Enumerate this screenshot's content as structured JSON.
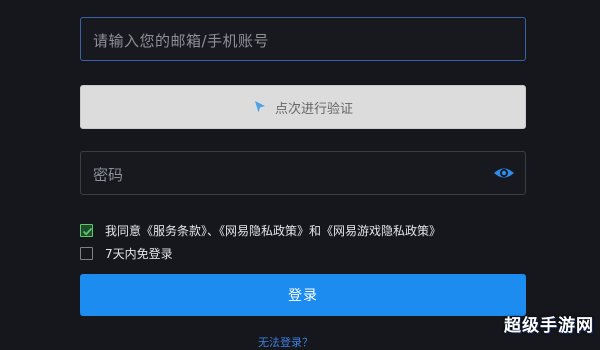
{
  "form": {
    "email_placeholder": "请输入您的邮箱/手机账号",
    "captcha_label": "点次进行验证",
    "password_placeholder": "密码",
    "agreement_text": "我同意《服务条款》、《网易隐私政策》和《网易游戏隐私政策》",
    "agreement_checked": true,
    "remember_text": "7天内免登录",
    "remember_checked": false,
    "login_button": "登录",
    "bottom_link": "无法登录？"
  },
  "watermark": "超级手游网",
  "icons": {
    "captcha": "pointer-arrow-icon",
    "password_toggle": "eye-icon",
    "checkbox": "checkmark-icon"
  },
  "colors": {
    "background": "#15171c",
    "primary": "#1d8cf0",
    "email_border": "#3a62a8",
    "check": "#5ec66b"
  }
}
